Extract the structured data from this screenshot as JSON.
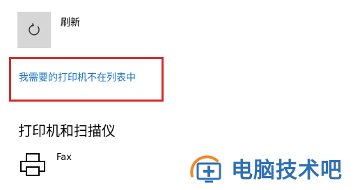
{
  "refresh": {
    "label": "刷新",
    "icon": "refresh-icon"
  },
  "missing_printer_link": {
    "label": "我需要的打印机不在列表中",
    "color": "#1a73c8",
    "highlight_color": "#d62a2a"
  },
  "printers_section": {
    "heading": "打印机和扫描仪",
    "devices": [
      {
        "name": "Fax",
        "icon": "printer-icon"
      }
    ]
  },
  "watermark": {
    "text": "电脑技术吧",
    "icon": "monitor-logo-icon",
    "text_color": "#2f6fb6",
    "accent_color": "#f08a24"
  }
}
